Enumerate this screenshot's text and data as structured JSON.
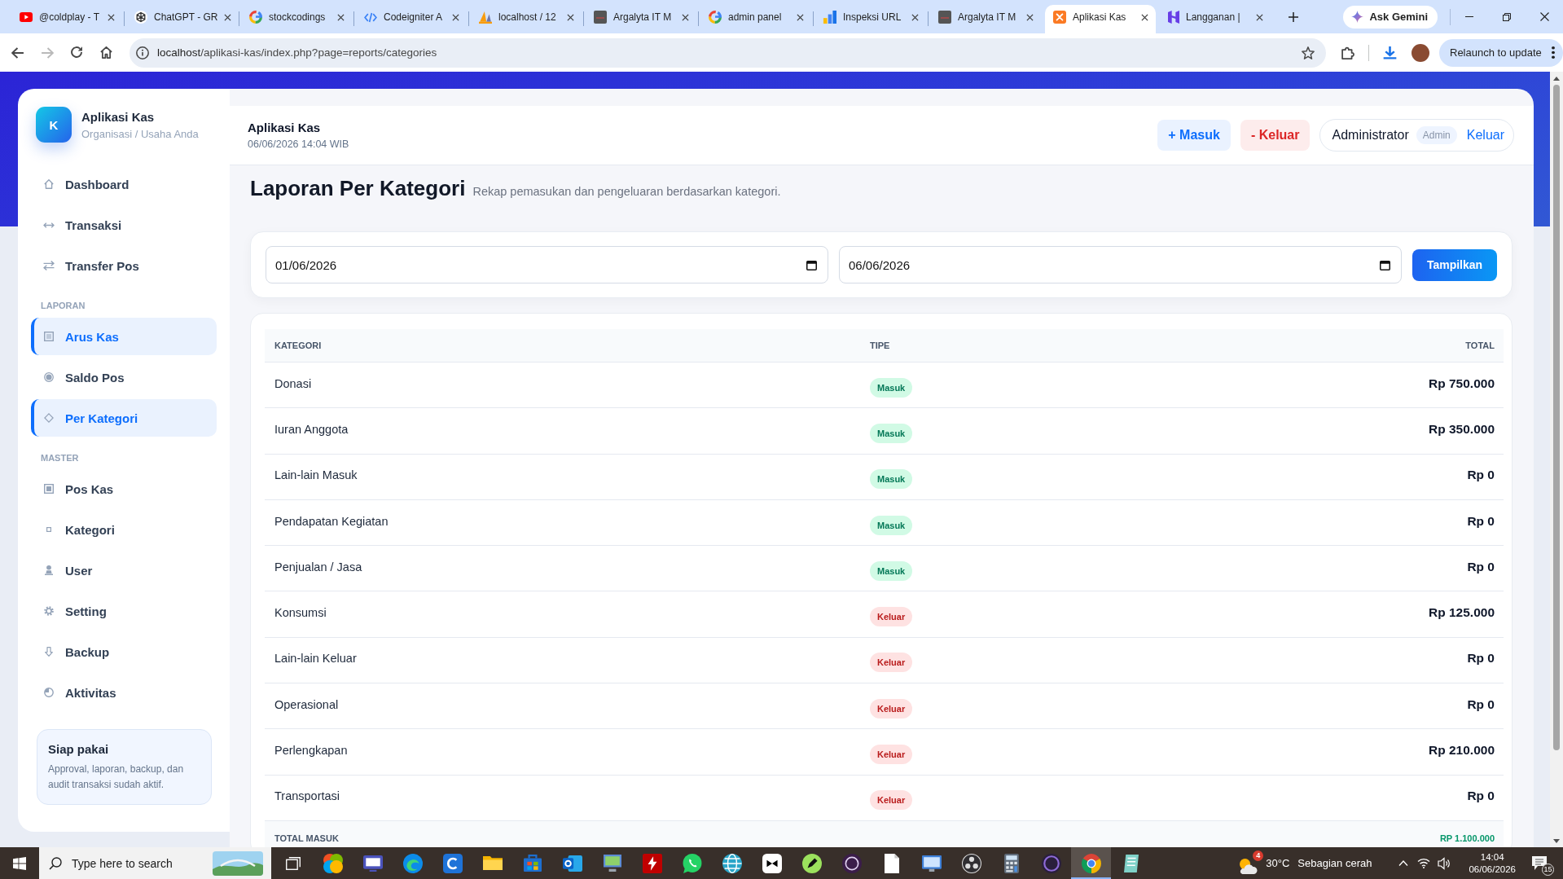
{
  "browser": {
    "tabs": [
      {
        "title": "@coldplay - T",
        "selected": false
      },
      {
        "title": "ChatGPT - GR",
        "selected": false
      },
      {
        "title": "stockcodings",
        "selected": false
      },
      {
        "title": "Codeigniter A",
        "selected": false
      },
      {
        "title": "localhost / 12",
        "selected": false
      },
      {
        "title": "Argalyta IT M",
        "selected": false
      },
      {
        "title": "admin panel",
        "selected": false
      },
      {
        "title": "Inspeksi URL",
        "selected": false
      },
      {
        "title": "Argalyta IT M",
        "selected": false
      },
      {
        "title": "Aplikasi Kas",
        "selected": true
      },
      {
        "title": "Langganan |",
        "selected": false
      }
    ],
    "ask_gemini": "Ask Gemini",
    "forward_disabled": true,
    "url": "localhost/aplikasi-kas/index.php?page=reports/categories",
    "relaunch": "Relaunch to update"
  },
  "sidebar": {
    "logo": "K",
    "name": "Aplikasi Kas",
    "tagline": "Organisasi / Usaha Anda",
    "sections": [
      {
        "items": [
          {
            "label": "Dashboard",
            "selected": false
          },
          {
            "label": "Transaksi",
            "selected": false
          },
          {
            "label": "Transfer Pos",
            "selected": false
          }
        ]
      },
      {
        "heading": "LAPORAN",
        "items": [
          {
            "label": "Arus Kas",
            "selected": true
          },
          {
            "label": "Saldo Pos",
            "selected": false
          },
          {
            "label": "Per Kategori",
            "selected": true
          }
        ]
      },
      {
        "heading": "MASTER",
        "items": [
          {
            "label": "Pos Kas",
            "selected": false
          },
          {
            "label": "Kategori",
            "selected": false
          },
          {
            "label": "User",
            "selected": false
          },
          {
            "label": "Setting",
            "selected": false
          },
          {
            "label": "Backup",
            "selected": false
          },
          {
            "label": "Aktivitas",
            "selected": false
          }
        ]
      }
    ],
    "info_card": {
      "title": "Siap pakai",
      "text": "Approval, laporan, backup, dan audit transaksi sudah aktif."
    }
  },
  "header": {
    "title": "Aplikasi Kas",
    "datetime": "06/06/2026 14:04 WIB",
    "actions": [
      {
        "label": "+ Masuk",
        "kind": "income"
      },
      {
        "label": "- Keluar",
        "kind": "expense"
      }
    ],
    "user": {
      "name": "Administrator",
      "role": "Admin",
      "logout": "Keluar"
    }
  },
  "page": {
    "title": "Laporan Per Kategori",
    "subtitle": "Rekap pemasukan dan pengeluaran berdasarkan kategori."
  },
  "filter": {
    "date_from": "01/06/2026",
    "date_to": "06/06/2026",
    "submit": "Tampilkan"
  },
  "table": {
    "columns": [
      "KATEGORI",
      "TIPE",
      "TOTAL"
    ],
    "rows": [
      {
        "category": "Donasi",
        "type": "Masuk",
        "kind": "income",
        "total": "Rp 750.000"
      },
      {
        "category": "Iuran Anggota",
        "type": "Masuk",
        "kind": "income",
        "total": "Rp 350.000"
      },
      {
        "category": "Lain-lain Masuk",
        "type": "Masuk",
        "kind": "income",
        "total": "Rp 0"
      },
      {
        "category": "Pendapatan Kegiatan",
        "type": "Masuk",
        "kind": "income",
        "total": "Rp 0"
      },
      {
        "category": "Penjualan / Jasa",
        "type": "Masuk",
        "kind": "income",
        "total": "Rp 0"
      },
      {
        "category": "Konsumsi",
        "type": "Keluar",
        "kind": "expense",
        "total": "Rp 125.000"
      },
      {
        "category": "Lain-lain Keluar",
        "type": "Keluar",
        "kind": "expense",
        "total": "Rp 0"
      },
      {
        "category": "Operasional",
        "type": "Keluar",
        "kind": "expense",
        "total": "Rp 0"
      },
      {
        "category": "Perlengkapan",
        "type": "Keluar",
        "kind": "expense",
        "total": "Rp 210.000"
      },
      {
        "category": "Transportasi",
        "type": "Keluar",
        "kind": "expense",
        "total": "Rp 0"
      }
    ],
    "footer": {
      "label": "TOTAL MASUK",
      "value": "RP 1.100.000",
      "kind": "income"
    }
  },
  "taskbar": {
    "search": {
      "placeholder": "Type here to search"
    },
    "apps": [
      {
        "selected": false
      },
      {
        "selected": false
      },
      {
        "selected": false
      },
      {
        "selected": false
      },
      {
        "selected": false
      },
      {
        "selected": false
      },
      {
        "selected": false
      },
      {
        "selected": false
      },
      {
        "selected": false
      },
      {
        "selected": false
      },
      {
        "selected": false
      },
      {
        "selected": false
      },
      {
        "selected": false
      },
      {
        "selected": false
      },
      {
        "selected": false
      },
      {
        "selected": false
      },
      {
        "selected": false
      },
      {
        "selected": false
      },
      {
        "selected": false
      },
      {
        "selected": true
      },
      {
        "selected": false
      }
    ],
    "weather": {
      "alerts": "4",
      "temperature": "30°C",
      "condition": "Sebagian cerah"
    },
    "time": "14:04",
    "date": "06/06/2026",
    "notifications": "15"
  }
}
